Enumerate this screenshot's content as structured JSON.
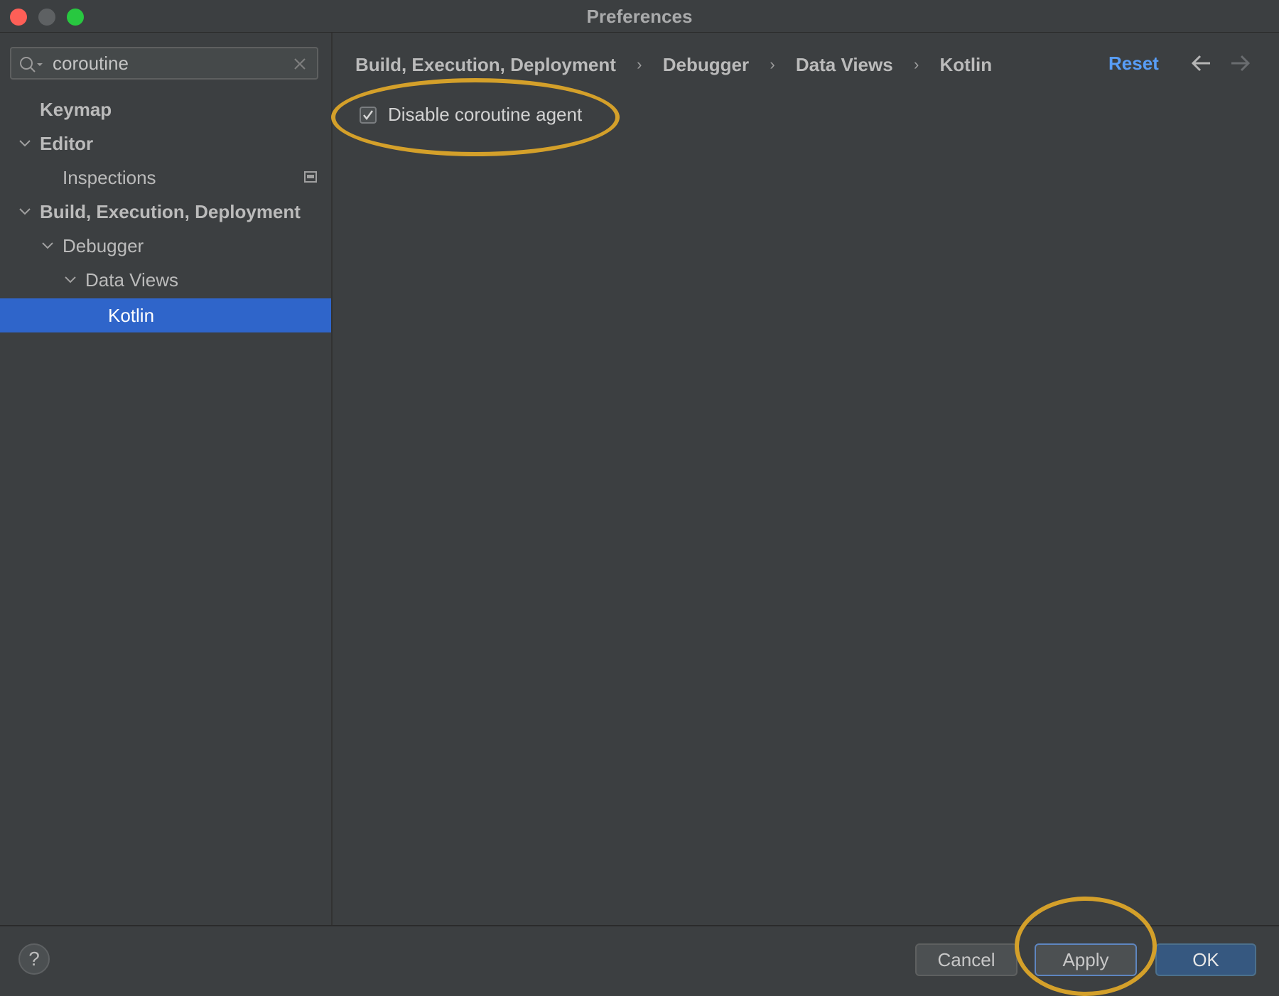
{
  "window": {
    "title": "Preferences"
  },
  "sidebar": {
    "search": {
      "value": "coroutine"
    },
    "items": [
      {
        "label": "Keymap"
      },
      {
        "label": "Editor"
      },
      {
        "label": "Inspections"
      },
      {
        "label": "Build, Execution, Deployment"
      },
      {
        "label": "Debugger"
      },
      {
        "label": "Data Views"
      },
      {
        "label": "Kotlin"
      }
    ]
  },
  "main": {
    "breadcrumb": [
      "Build, Execution, Deployment",
      "Debugger",
      "Data Views",
      "Kotlin"
    ],
    "reset_label": "Reset",
    "option": {
      "label": "Disable coroutine agent",
      "checked": true
    }
  },
  "footer": {
    "help_label": "?",
    "cancel_label": "Cancel",
    "apply_label": "Apply",
    "ok_label": "OK"
  },
  "colors": {
    "accent": "#589df6",
    "selection": "#2f65ca",
    "annotation": "#d4a02a",
    "background": "#3c3f41"
  }
}
